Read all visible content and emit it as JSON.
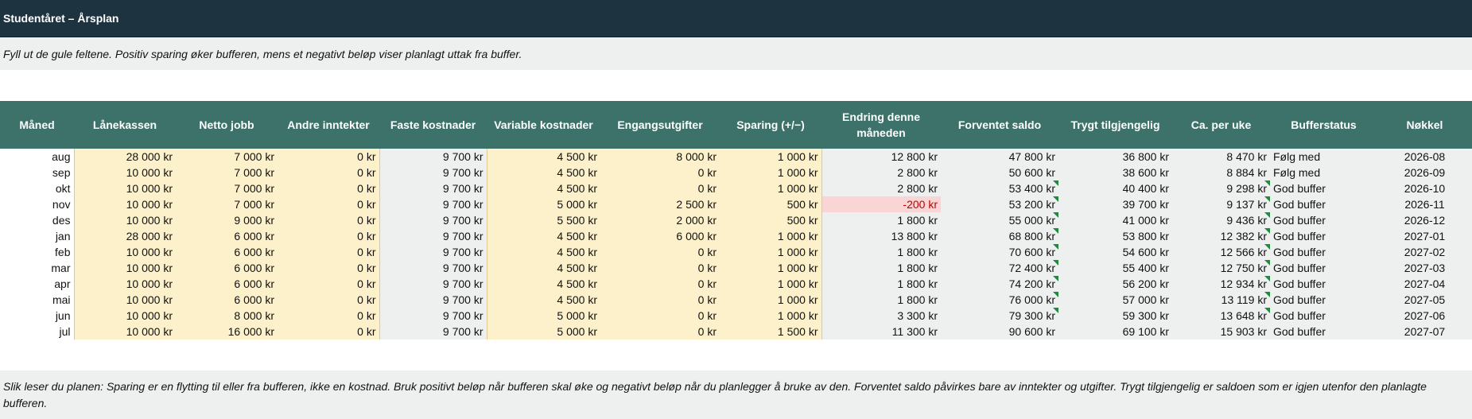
{
  "title": "Studentåret – Årsplan",
  "intro": "Fyll ut de gule feltene. Positiv sparing øker bufferen, mens et negativt beløp viser planlagt uttak fra buffer.",
  "columns": {
    "maned": "Måned",
    "lanekassen": "Lånekassen",
    "netto_jobb": "Netto jobb",
    "andre_inntekter": "Andre inntekter",
    "faste_kostnader": "Faste kostnader",
    "variable_kostnader": "Variable kostnader",
    "engangsutgifter": "Engangsutgifter",
    "sparing": "Sparing (+/−)",
    "endring": "Endring denne måneden",
    "forventet_saldo": "Forventet saldo",
    "trygt_tilgjengelig": "Trygt tilgjengelig",
    "ca_per_uke": "Ca. per uke",
    "bufferstatus": "Bufferstatus",
    "nokkel": "Nøkkel"
  },
  "rows": [
    [
      "aug",
      "28 000 kr",
      "7 000 kr",
      "0 kr",
      "9 700 kr",
      "4 500 kr",
      "8 000 kr",
      "1 000 kr",
      "12 800 kr",
      "47 800 kr",
      "36 800 kr",
      "8 470 kr",
      "Følg med",
      "2026-08"
    ],
    [
      "sep",
      "10 000 kr",
      "7 000 kr",
      "0 kr",
      "9 700 kr",
      "4 500 kr",
      "0 kr",
      "1 000 kr",
      "2 800 kr",
      "50 600 kr",
      "38 600 kr",
      "8 884 kr",
      "Følg med",
      "2026-09"
    ],
    [
      "okt",
      "10 000 kr",
      "7 000 kr",
      "0 kr",
      "9 700 kr",
      "4 500 kr",
      "0 kr",
      "1 000 kr",
      "2 800 kr",
      "53 400 kr",
      "40 400 kr",
      "9 298 kr",
      "God buffer",
      "2026-10"
    ],
    [
      "nov",
      "10 000 kr",
      "7 000 kr",
      "0 kr",
      "9 700 kr",
      "5 000 kr",
      "2 500 kr",
      "500 kr",
      "-200 kr",
      "53 200 kr",
      "39 700 kr",
      "9 137 kr",
      "God buffer",
      "2026-11"
    ],
    [
      "des",
      "10 000 kr",
      "9 000 kr",
      "0 kr",
      "9 700 kr",
      "5 500 kr",
      "2 000 kr",
      "500 kr",
      "1 800 kr",
      "55 000 kr",
      "41 000 kr",
      "9 436 kr",
      "God buffer",
      "2026-12"
    ],
    [
      "jan",
      "28 000 kr",
      "6 000 kr",
      "0 kr",
      "9 700 kr",
      "4 500 kr",
      "6 000 kr",
      "1 000 kr",
      "13 800 kr",
      "68 800 kr",
      "53 800 kr",
      "12 382 kr",
      "God buffer",
      "2027-01"
    ],
    [
      "feb",
      "10 000 kr",
      "6 000 kr",
      "0 kr",
      "9 700 kr",
      "4 500 kr",
      "0 kr",
      "1 000 kr",
      "1 800 kr",
      "70 600 kr",
      "54 600 kr",
      "12 566 kr",
      "God buffer",
      "2027-02"
    ],
    [
      "mar",
      "10 000 kr",
      "6 000 kr",
      "0 kr",
      "9 700 kr",
      "4 500 kr",
      "0 kr",
      "1 000 kr",
      "1 800 kr",
      "72 400 kr",
      "55 400 kr",
      "12 750 kr",
      "God buffer",
      "2027-03"
    ],
    [
      "apr",
      "10 000 kr",
      "6 000 kr",
      "0 kr",
      "9 700 kr",
      "4 500 kr",
      "0 kr",
      "1 000 kr",
      "1 800 kr",
      "74 200 kr",
      "56 200 kr",
      "12 934 kr",
      "God buffer",
      "2027-04"
    ],
    [
      "mai",
      "10 000 kr",
      "6 000 kr",
      "0 kr",
      "9 700 kr",
      "4 500 kr",
      "0 kr",
      "1 000 kr",
      "1 800 kr",
      "76 000 kr",
      "57 000 kr",
      "13 119 kr",
      "God buffer",
      "2027-05"
    ],
    [
      "jun",
      "10 000 kr",
      "8 000 kr",
      "0 kr",
      "9 700 kr",
      "5 000 kr",
      "0 kr",
      "1 000 kr",
      "3 300 kr",
      "79 300 kr",
      "59 300 kr",
      "13 648 kr",
      "God buffer",
      "2027-06"
    ],
    [
      "jul",
      "10 000 kr",
      "16 000 kr",
      "0 kr",
      "9 700 kr",
      "5 000 kr",
      "0 kr",
      "1 500 kr",
      "11 300 kr",
      "90 600 kr",
      "69 100 kr",
      "15 903 kr",
      "God buffer",
      "2027-07"
    ]
  ],
  "flagged_rows": [
    2,
    3,
    4,
    5,
    6,
    7,
    8,
    9,
    10
  ],
  "negative_rows": [
    3
  ],
  "outro": "Slik leser du planen: Sparing er en flytting til eller fra bufferen, ikke en kostnad. Bruk positivt beløp når bufferen skal øke og negativt beløp når du planlegger å bruke av den. Forventet saldo påvirkes bare av inntekter og utgifter. Trygt tilgjengelig er saldoen som er igjen utenfor den planlagte bufferen."
}
